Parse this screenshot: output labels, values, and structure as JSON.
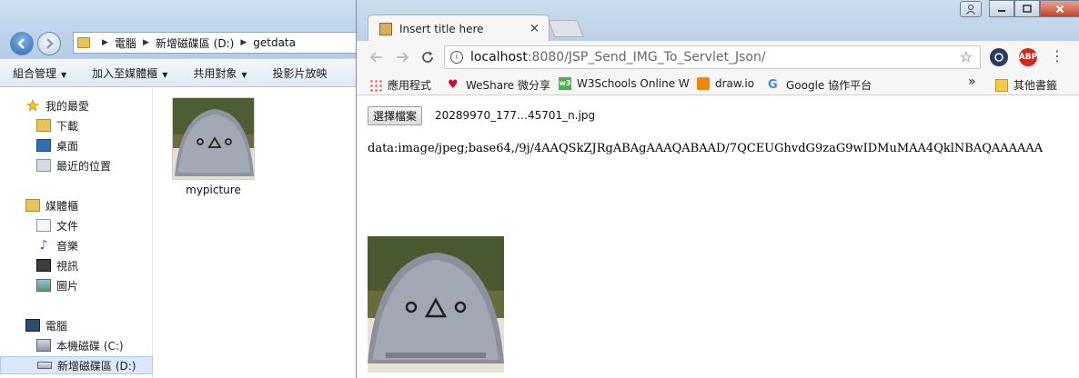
{
  "explorer": {
    "breadcrumb": [
      "電腦",
      "新增磁碟區 (D:)",
      "getdata"
    ],
    "toolbar": [
      "組合管理",
      "加入至媒體櫃",
      "共用對象",
      "投影片放映"
    ],
    "favorites": {
      "header": "我的最愛",
      "items": [
        "下載",
        "桌面",
        "最近的位置"
      ]
    },
    "libraries": {
      "header": "媒體櫃",
      "items": [
        "文件",
        "音樂",
        "視訊",
        "圖片"
      ]
    },
    "computer": {
      "header": "電腦",
      "items": [
        "本機磁碟 (C:)",
        "新增磁碟區 (D:)"
      ]
    },
    "file": {
      "name": "mypicture"
    }
  },
  "chrome": {
    "tab_title": "Insert title here",
    "tab_close": "×",
    "url_host": "localhost",
    "url_path": ":8080/JSP_Send_IMG_To_Servlet_Json/",
    "bookmarks": [
      "應用程式",
      "WeShare 微分享",
      "W3Schools Online W",
      "draw.io",
      "Google 協作平台"
    ],
    "bookmarks_more": "»",
    "bookmarks_other": "其他書籤",
    "ext_abp": "ABP"
  },
  "page": {
    "file_button": "選擇檔案",
    "file_chosen": "20289970_177…45701_n.jpg",
    "base64": "data:image/jpeg;base64,/9j/4AAQSkZJRgABAgAAAQABAAD/7QCEUGhvdG9zaG9wIDMuMAA4QklNBAQAAAAAA"
  },
  "colors": {
    "abp": "#d9261c",
    "explorer_frame": "#bcd3ea",
    "selection": "#dbe8f7"
  }
}
